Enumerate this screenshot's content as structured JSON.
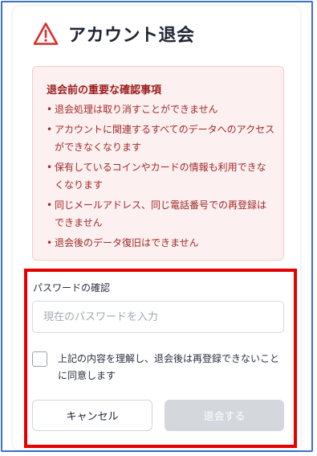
{
  "header": {
    "icon": "warning-triangle-icon",
    "title": "アカウント退会"
  },
  "notice": {
    "title": "退会前の重要な確認事項",
    "items": [
      "退会処理は取り消すことができません",
      "アカウントに関連するすべてのデータへのアクセスができなくなります",
      "保有しているコインやカードの情報も利用できなくなります",
      "同じメールアドレス、同じ電話番号での再登録はできません",
      "退会後のデータ復旧はできません"
    ]
  },
  "password": {
    "label": "パスワードの確認",
    "placeholder": "現在のパスワードを入力",
    "value": ""
  },
  "agreement": {
    "label": "上記の内容を理解し、退会後は再登録できないことに同意します",
    "checked": false
  },
  "buttons": {
    "cancel": "キャンセル",
    "withdraw": "退会する",
    "withdraw_enabled": false
  },
  "colors": {
    "warning": "#d92d2d",
    "notice_bg": "#fdf0f0",
    "notice_text": "#a12a2a",
    "highlight_border": "#e60000",
    "disabled_button": "#d4d7dc"
  }
}
